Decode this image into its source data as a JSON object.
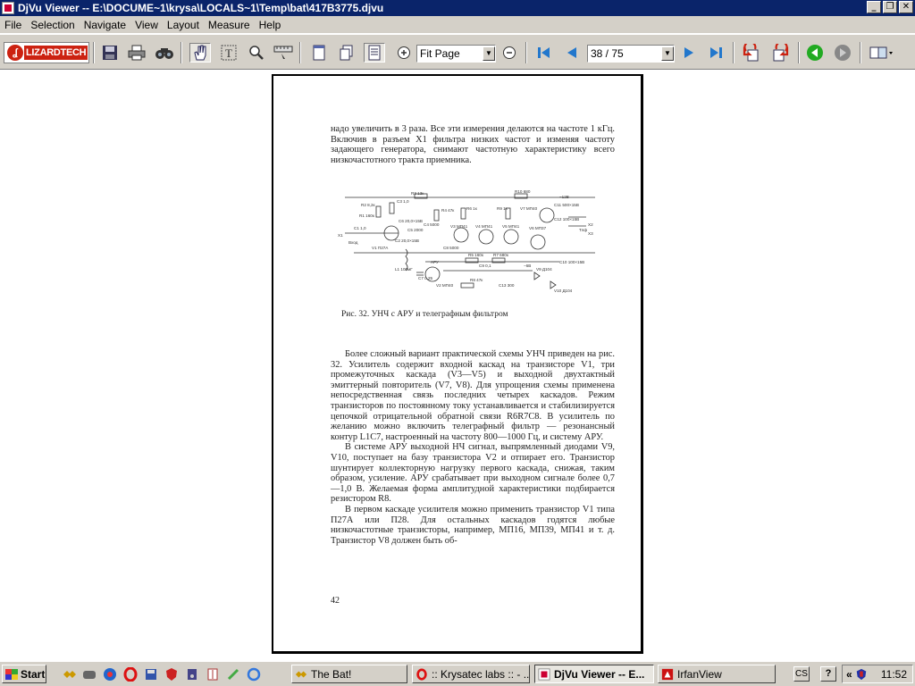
{
  "window": {
    "title": "DjVu Viewer -- E:\\DOCUME~1\\krysa\\LOCALS~1\\Temp\\bat\\417B3775.djvu",
    "minimize": "_",
    "restore": "❐",
    "close": "✕"
  },
  "menu": [
    "File",
    "Selection",
    "Navigate",
    "View",
    "Layout",
    "Measure",
    "Help"
  ],
  "toolbar": {
    "logo": "LIZARDTECH",
    "zoom_value": "Fit Page",
    "page_value": "38 / 75",
    "icons": [
      "save-icon",
      "print-icon",
      "find-icon",
      "hand-tool-icon",
      "text-select-icon",
      "zoom-select-icon",
      "ruler-icon",
      "single-page-icon",
      "continuous-page-icon",
      "fit-page-icon",
      "zoom-in-icon",
      "zoom-out-icon",
      "first-page-icon",
      "previous-page-icon",
      "next-page-icon",
      "last-page-icon",
      "back-icon",
      "forward-icon",
      "go-green-icon",
      "go-gray-icon",
      "book-icon"
    ]
  },
  "document": {
    "para1": "надо увеличить в 3 раза. Все эти измерения делаются на частоте 1 кГц. Включив в разъем X1 фильтра низких частот и изменяя частоту задающего генератора, снимают частотную характеристику всего низкочастотного тракта приемника.",
    "schematic_labels": [
      "R3 13к",
      "R10 680",
      "−12В",
      "R2 8,2к",
      "R1 160к",
      "C3 1,0",
      "R4 47к",
      "R6 1к",
      "R9 1к",
      "V7 МП40",
      "C11 500×15В",
      "C1 1,0",
      "C4 5000",
      "C5 2000",
      "C6 20,0×15В",
      "V3 МП41",
      "V4 МП41",
      "V5 МП41",
      "V6 МП37",
      "C12 100×15В",
      "X2",
      "X3",
      "X1",
      "Вход",
      "V1 П27А",
      "C2 20,0×15В",
      "C8 5000",
      "R5 160к",
      "R7 680к",
      "C9 0,1",
      "−6В",
      "Тлф",
      "L1 100мГ",
      "C7 0,25",
      "V2 МП40",
      "R8 47к",
      "C13 300",
      "V9 Д104",
      "V10 Д104",
      "C10 100×15В",
      "АРУ"
    ],
    "caption": "Рис. 32. УНЧ с АРУ и телеграфным фильтром",
    "para2": "Более сложный вариант практической схемы УНЧ приведен на рис. 32. Усилитель содержит входной каскад на транзисторе V1, три промежуточных каскада (V3—V5) и выходной двухтактный эмиттерный повторитель (V7, V8). Для упрощения схемы применена непосредственная связь последних четырех каскадов. Режим транзисторов по постоянному току устанавливается и стабилизируется цепочкой отрицательной обратной связи R6R7C8. В усилитель по желанию можно включить телеграфный фильтр — резонансный контур L1C7, настроенный на частоту 800—1000 Гц, и систему АРУ.",
    "para3": "В системе АРУ выходной НЧ сигнал, выпрямленный диодами V9, V10, поступает на базу транзистора V2 и отпирает его. Транзистор шунтирует коллекторную нагрузку первого каскада, снижая, таким образом, усиление. АРУ срабатывает при выходном сигнале более 0,7—1,0 В. Желаемая форма амплитудной характеристики подбирается резистором R8.",
    "para4": "В первом каскаде усилителя можно применить транзистор V1 типа П27А или П28. Для остальных каскадов годятся любые низкочастотные транзисторы, например, МП16, МП39, МП41 и т. д. Транзистор V8 должен быть об-",
    "page_number": "42"
  },
  "taskbar": {
    "start": "Start",
    "tasks": [
      "The Bat!",
      ":: Krysatec labs :: - ...",
      "DjVu Viewer -- E...",
      "IrfanView"
    ],
    "tray_cs": "CS",
    "tray_help": "?",
    "tray_chevron": "«",
    "clock": "11:52"
  }
}
